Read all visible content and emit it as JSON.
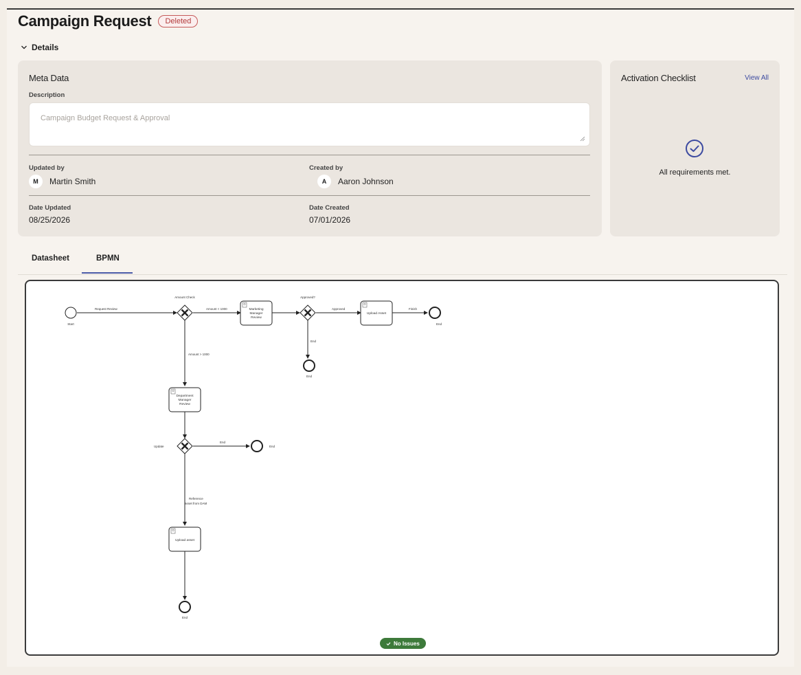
{
  "header": {
    "title": "Campaign Request",
    "status_badge": "Deleted"
  },
  "details": {
    "toggle_label": "Details"
  },
  "meta": {
    "title": "Meta Data",
    "description_label": "Description",
    "description_value": "Campaign Budget Request & Approval",
    "updated_by_label": "Updated by",
    "updated_by_initial": "M",
    "updated_by_name": "Martin Smith",
    "created_by_label": "Created by",
    "created_by_initial": "A",
    "created_by_name": "Aaron Johnson",
    "date_updated_label": "Date Updated",
    "date_updated_value": "08/25/2026",
    "date_created_label": "Date Created",
    "date_created_value": "07/01/2026"
  },
  "checklist": {
    "title": "Activation Checklist",
    "view_all": "View All",
    "message": "All requirements met."
  },
  "tabs": [
    {
      "label": "Datasheet"
    },
    {
      "label": "BPMN"
    }
  ],
  "active_tab": "BPMN",
  "bpmn": {
    "start_event": "Start",
    "flow_request_review": "Request Review",
    "gateway_amount_check": "Amount Check",
    "flow_amount_lt": "Amount < 1000",
    "task_marketing_review": [
      "Marketing",
      "Manager",
      "Review"
    ],
    "gateway_approved": "Approved?",
    "flow_approved": "Approved",
    "task_upload_asset": "Upload Asset",
    "flow_finish": "Finish",
    "end_label": "End",
    "flow_amount_gt": "Amount > 1000",
    "task_department_review": [
      "Department",
      "Manager",
      "Review"
    ],
    "flow_update": "Update",
    "flow_reference": [
      "Reference",
      "asset from DAM"
    ],
    "task_upload_asset_2": "Upload asset"
  },
  "status": {
    "label": "No Issues"
  },
  "colors": {
    "accent": "#4a5aa8",
    "deleted": "#c65a5a",
    "success": "#3d7a3a"
  }
}
